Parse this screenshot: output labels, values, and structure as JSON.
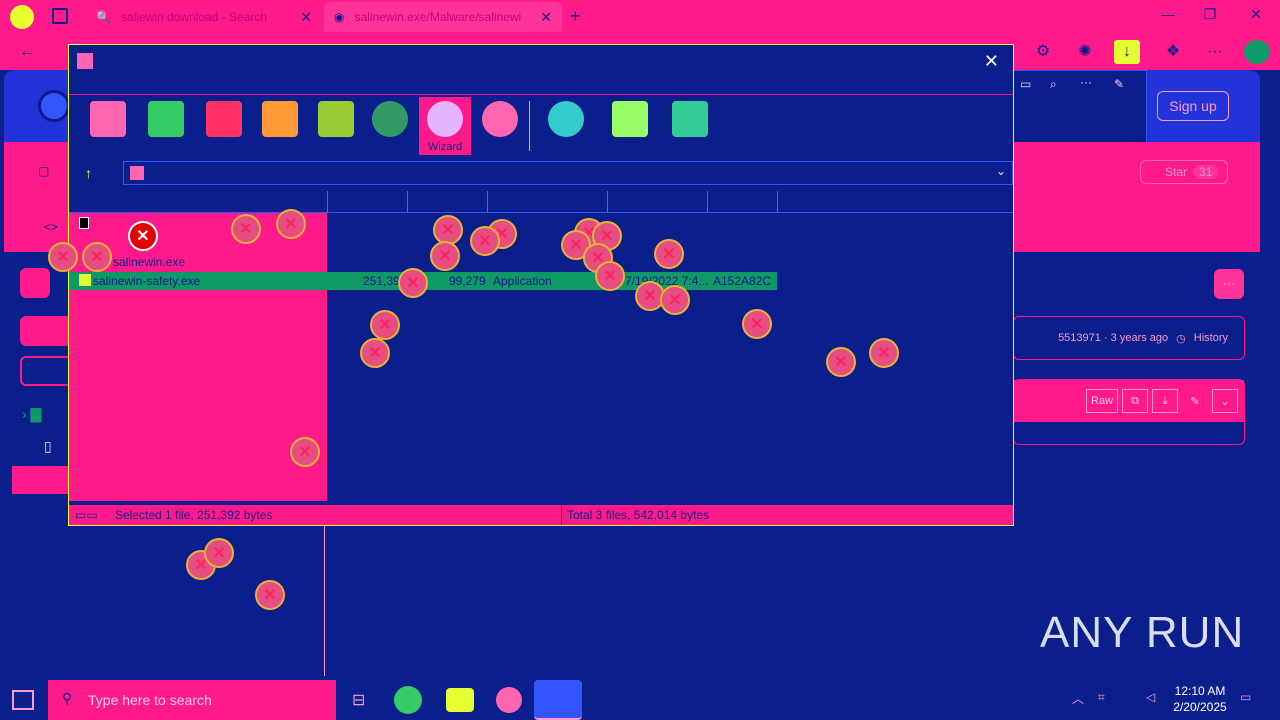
{
  "browser": {
    "tabs": [
      {
        "label": "saliewin download - Search"
      },
      {
        "label": "salinewin.exe/Malware/salinewi"
      }
    ],
    "new_tab": "+",
    "win_controls": {
      "minimize": "—",
      "maximize": "❐",
      "close": "✕"
    }
  },
  "page": {
    "signup": "Sign up",
    "star_label": "Star",
    "star_count": "31",
    "commit_info": "5513971 · 3 years ago",
    "history": "History",
    "raw": "Raw",
    "more": "···"
  },
  "winrar": {
    "close": "✕",
    "toolbar": [
      {
        "name": "add",
        "label": ""
      },
      {
        "name": "extract",
        "label": ""
      },
      {
        "name": "test",
        "label": ""
      },
      {
        "name": "view",
        "label": ""
      },
      {
        "name": "delete",
        "label": ""
      },
      {
        "name": "find",
        "label": ""
      },
      {
        "name": "wizard",
        "label": "Wizard"
      },
      {
        "name": "info",
        "label": ""
      },
      {
        "name": "virusscan",
        "label": ""
      },
      {
        "name": "comment",
        "label": ""
      },
      {
        "name": "sfx",
        "label": ""
      }
    ],
    "files": [
      {
        "name": "salinewin.exe"
      },
      {
        "name": "salinewin-safety.exe",
        "size": "251,392",
        "packed": "99,279",
        "type": "Application",
        "modified": "7/19/2022 7:4...",
        "crc": "A152A82C"
      }
    ],
    "status_left": "Selected 1 file, 251,392 bytes",
    "status_right": "Total 3 files, 542,014 bytes"
  },
  "taskbar": {
    "search_placeholder": "Type here to search",
    "time": "12:10 AM",
    "date": "2/20/2025"
  },
  "watermark": "ANY RUN"
}
